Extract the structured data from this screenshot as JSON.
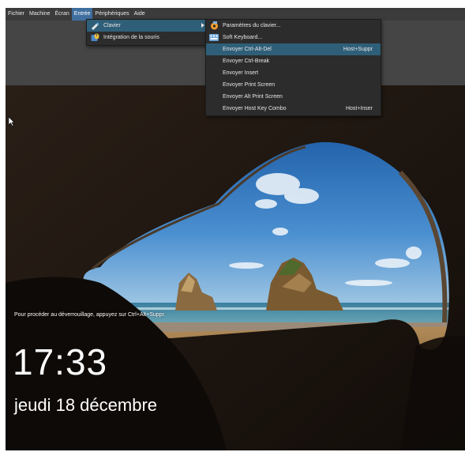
{
  "menubar": {
    "items": [
      {
        "label": "Fichier"
      },
      {
        "label": "Machine"
      },
      {
        "label": "Écran"
      },
      {
        "label": "Entrée"
      },
      {
        "label": "Périphériques"
      },
      {
        "label": "Aide"
      }
    ],
    "active_index": 3
  },
  "submenu_entree": {
    "items": [
      {
        "label": "Clavier",
        "icon": "keyboard-pen-icon",
        "has_submenu": true
      },
      {
        "label": "Intégration de la souris",
        "icon": "mouse-integration-icon"
      }
    ]
  },
  "submenu_clavier": {
    "items": [
      {
        "label": "Paramètres du clavier...",
        "icon": "keyboard-settings-icon",
        "shortcut": ""
      },
      {
        "label": "Soft Keyboard...",
        "icon": "soft-keyboard-icon",
        "shortcut": ""
      },
      {
        "label": "Envoyer Ctrl-Alt-Del",
        "shortcut": "Host+Suppr"
      },
      {
        "label": "Envoyer Ctrl-Break",
        "shortcut": ""
      },
      {
        "label": "Envoyer Insert",
        "shortcut": ""
      },
      {
        "label": "Envoyer Print Screen",
        "shortcut": ""
      },
      {
        "label": "Envoyer Alt Print Screen",
        "shortcut": ""
      },
      {
        "label": "Envoyer Host Key Combo",
        "shortcut": "Host+Inser"
      }
    ],
    "highlighted_index": 2
  },
  "lockscreen": {
    "hint": "Pour procéder au déverrouillage, appuyez sur Ctrl+Alt+Suppr.",
    "time": "17:33",
    "date": "jeudi 18 décembre"
  },
  "colors": {
    "menubar_bg": "#3b3b3b",
    "menu_bg": "#2c2c2c",
    "highlight": "#2f5f78",
    "active_menu": "#3f6f9f"
  }
}
